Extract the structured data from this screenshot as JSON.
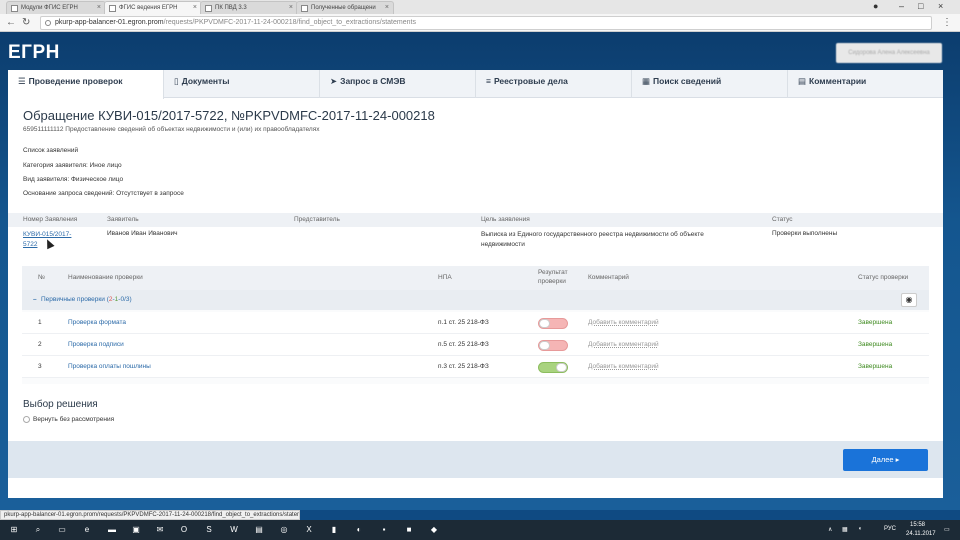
{
  "browser": {
    "tabs": [
      {
        "label": "Модули ФГИС ЕГРН",
        "active": false
      },
      {
        "label": "ФГИС ведения ЕГРН",
        "active": true
      },
      {
        "label": "ПК ПВД 3.3",
        "active": false
      },
      {
        "label": "Полученные обращени",
        "active": false
      }
    ],
    "url_host": "pkurp-app-balancer-01.egron.prom",
    "url_path": "/requests/PKPVDMFC-2017-11-24-000218/find_object_to_extractions/statements",
    "status_url": "pkurp-app-balancer-01.egron.prom/requests/PKPVDMFC-2017-11-24-000218/find_object_to_extractions/statements#"
  },
  "app": {
    "logo": "ЕГРН",
    "user_name": "Сидорова Алена Алексеевна",
    "nav_tabs": [
      {
        "label": "Проведение проверок",
        "icon": "checklist-icon",
        "active": true
      },
      {
        "label": "Документы",
        "icon": "document-icon",
        "active": false
      },
      {
        "label": "Запрос в СМЭВ",
        "icon": "send-icon",
        "active": false
      },
      {
        "label": "Реестровые дела",
        "icon": "list-icon",
        "active": false
      },
      {
        "label": "Поиск сведений",
        "icon": "table-icon",
        "active": false
      },
      {
        "label": "Комментарии",
        "icon": "comments-icon",
        "active": false
      }
    ]
  },
  "request": {
    "title": "Обращение КУВИ-015/2017-5722, №PKPVDMFC-2017-11-24-000218",
    "subtitle": "659511111112 Предоставление сведений об объектах недвижимости и (или) их правообладателях",
    "list_label": "Список заявлений",
    "category": "Категория заявителя: Иное лицо",
    "applicant_type": "Вид заявителя: Физическое лицо",
    "basis": "Основание запроса сведений: Отсутствует в запросе"
  },
  "statement_table": {
    "headers": [
      "Номер Заявления",
      "Заявитель",
      "Представитель",
      "Цель заявления",
      "Статус"
    ],
    "row": {
      "number": "КУВИ-015/2017-5722",
      "applicant": "Иванов Иван Иванович",
      "representative": "",
      "purpose": "Выписка из Единого государственного реестра недвижимости об объекте недвижимости",
      "status": "Проверки выполнены"
    }
  },
  "checks": {
    "headers": {
      "num": "№",
      "name": "Наименование проверки",
      "npa": "НПА",
      "result": "Результат проверки",
      "comment": "Комментарий",
      "status": "Статус проверки"
    },
    "group": {
      "label": "Первичные проверки",
      "counts_open": "(",
      "red": "2",
      "sep1": "-",
      "green": "1",
      "sep2": "-",
      "blue": "0/3",
      "counts_close": ")"
    },
    "rows": [
      {
        "num": "1",
        "name": "Проверка формата",
        "npa": "п.1 ст. 25 218-ФЗ",
        "result": "fail",
        "comment": "Добавить комментарий",
        "status": "Завершена"
      },
      {
        "num": "2",
        "name": "Проверка подписи",
        "npa": "п.5 ст. 25 218-ФЗ",
        "result": "fail",
        "comment": "Добавить комментарий",
        "status": "Завершена"
      },
      {
        "num": "3",
        "name": "Проверка оплаты пошлины",
        "npa": "п.3 ст. 25 218-ФЗ",
        "result": "pass",
        "comment": "Добавить комментарий",
        "status": "Завершена"
      }
    ]
  },
  "decision": {
    "heading": "Выбор решения",
    "option": "Вернуть без рассмотрения"
  },
  "footer": {
    "next_label": "Далее ▸"
  },
  "taskbar": {
    "lang": "РУС",
    "time": "15:58",
    "date": "24.11.2017"
  },
  "colors": {
    "brand_blue": "#0f4a82",
    "accent": "#1a73d9",
    "link": "#2b6aa8",
    "ok": "#3e8a1f",
    "fail": "#f5b5b5"
  }
}
